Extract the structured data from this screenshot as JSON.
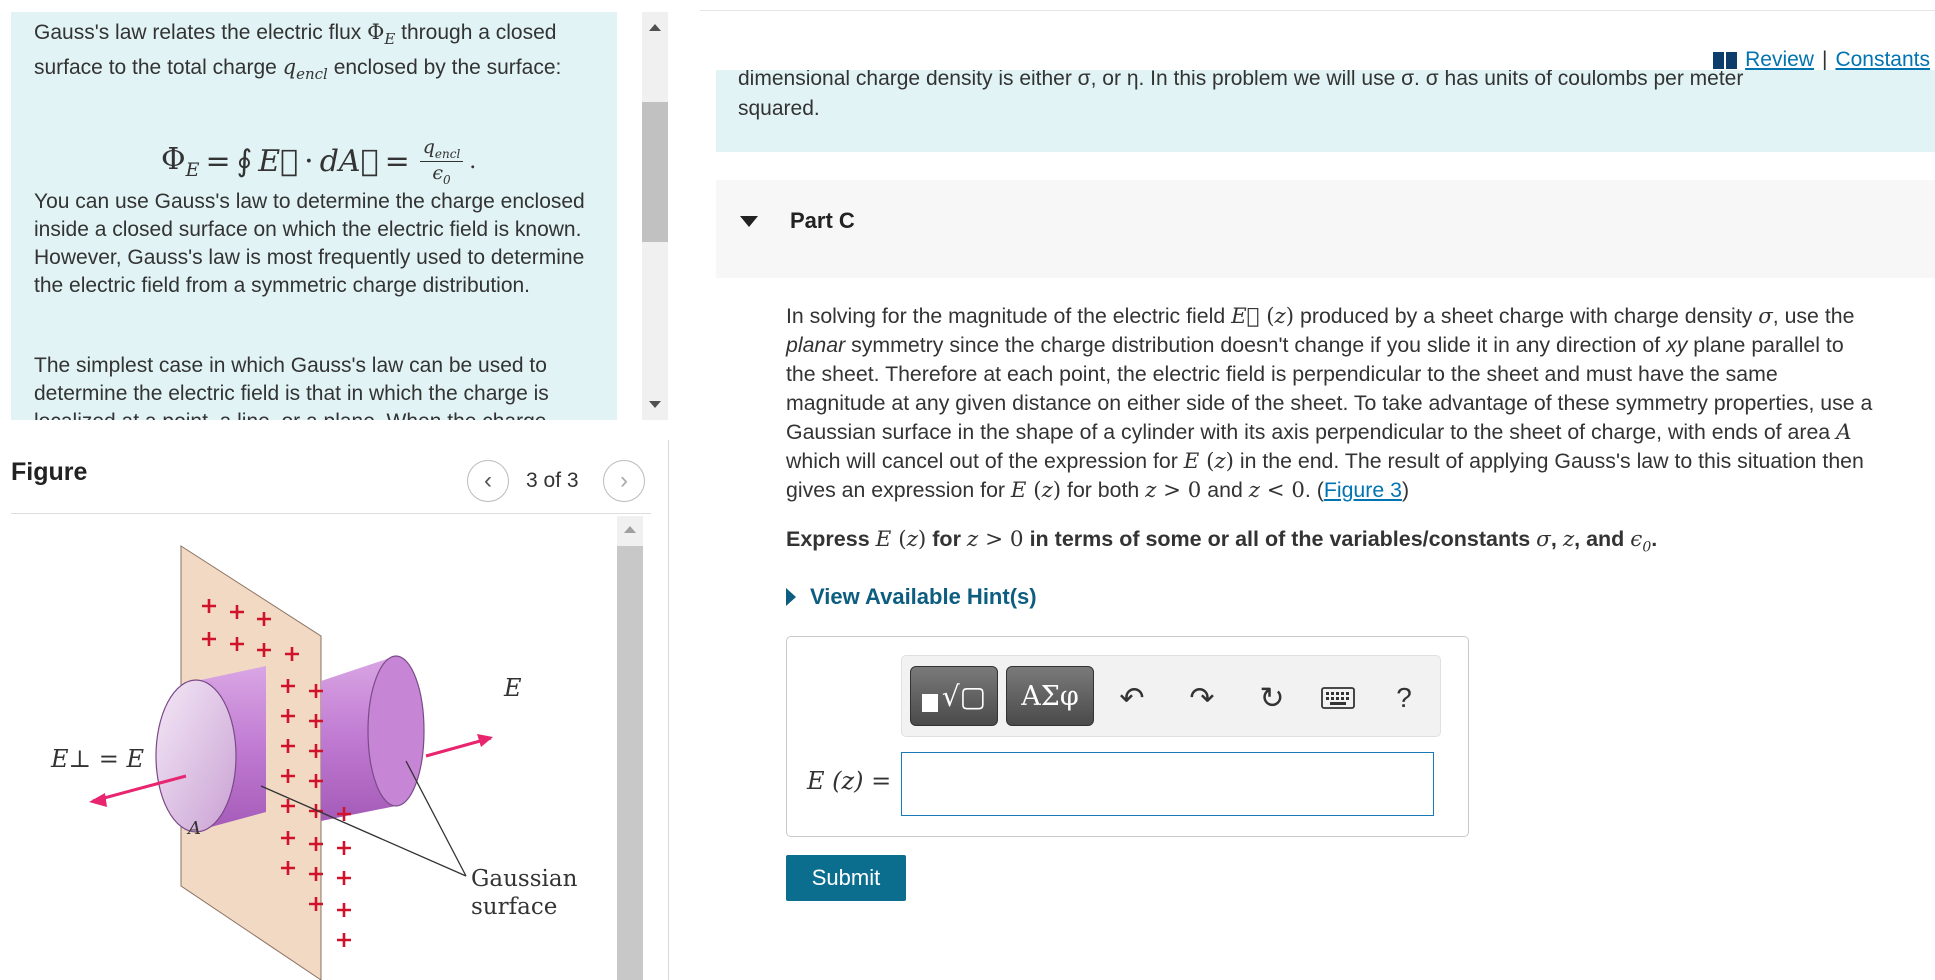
{
  "intro": {
    "p1_a": "Gauss's law relates the electric flux ",
    "p1_b": " through a closed surface to the total charge ",
    "p1_c": " enclosed by the surface:",
    "flux_symbol": "ΦE",
    "q_symbol": "qencl",
    "p2": "You can use Gauss's law to determine the charge enclosed inside a closed surface on which the electric field is known. However, Gauss's law is most frequently used to determine the electric field from a symmetric charge distribution.",
    "p3": "The simplest case in which Gauss's law can be used to determine the electric field is that in which the charge is localized at a point, a line, or a plane. When the charge"
  },
  "figure": {
    "title": "Figure",
    "counter": "3 of 3",
    "label_e": "E",
    "label_e_perp": "E⊥ = E",
    "label_a": "A",
    "label_gaussian_1": "Gaussian",
    "label_gaussian_2": "surface"
  },
  "header": {
    "review_label": "Review",
    "separator": "|",
    "constants_label": "Constants"
  },
  "prev_context": {
    "line1": "dimensional charge density is either σ, or η. In this problem we will use σ. σ has units of coulombs per meter",
    "line2": "squared."
  },
  "part": {
    "title": "Part C"
  },
  "problem": {
    "l1_a": "In solving for the magnitude of the electric field ",
    "l1_b": " produced by a sheet charge with charge density ",
    "l1_c": ", use the",
    "l2_a": "planar",
    "l2_b": " symmetry since the charge distribution doesn't change if you slide it in any direction of ",
    "l2_c": "xy",
    "l2_d": " plane parallel to",
    "l3": "the sheet. Therefore at each point, the electric field is perpendicular to the sheet and must have the same",
    "l4": "magnitude at any given distance on either side of the sheet. To take advantage of these symmetry properties, use a",
    "l5_a": "Gaussian surface in the shape of a cylinder with its axis perpendicular to the sheet of charge, with ends of area ",
    "l6_a": "which will cancel out of the expression for ",
    "l6_b": " in the end. The result of applying Gauss's law to this situation then",
    "l7_a": "gives an expression for ",
    "l7_b": " for both ",
    "l7_c": " and ",
    "l7_d": ". (",
    "figure_link": "Figure 3",
    "l7_e": ")",
    "express_a": "Express ",
    "express_b": " for ",
    "express_c": " in terms of some or all of the variables/constants ",
    "express_d": ", ",
    "express_e": ", and ",
    "express_f": "."
  },
  "hints": {
    "label": "View Available Hint(s)"
  },
  "answer": {
    "greek_label": "ΑΣφ",
    "help_label": "?",
    "label": "E (z) =",
    "value": ""
  },
  "submit": {
    "label": "Submit"
  },
  "colors": {
    "accent": "#0b6e8f",
    "link": "#0073b1",
    "intro_bg": "#e1f3f5",
    "field_arrow": "#e8256f",
    "cylinder": "#c585d4"
  }
}
